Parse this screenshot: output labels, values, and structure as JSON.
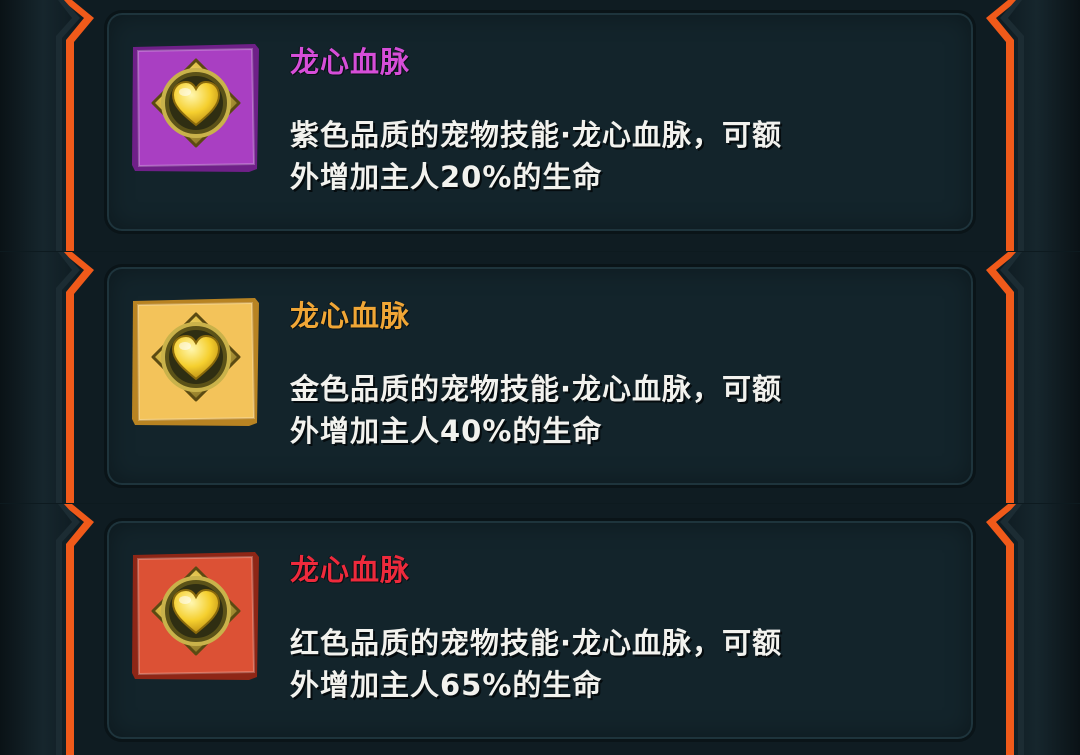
{
  "skills": [
    {
      "name": "龙心血脉",
      "name_color": "#d64ed8",
      "frame_color": "#a93fc2",
      "frame_edge": "#6f2088",
      "icon": "golden-heart-emblem-icon",
      "description_line1": "紫色品质的宠物技能·龙心血脉，可额",
      "description_line2": "外增加主人20%的生命"
    },
    {
      "name": "龙心血脉",
      "name_color": "#f0a636",
      "frame_color": "#f3c35a",
      "frame_edge": "#b88322",
      "icon": "golden-heart-emblem-icon",
      "description_line1": "金色品质的宠物技能·龙心血脉，可额",
      "description_line2": "外增加主人40%的生命"
    },
    {
      "name": "龙心血脉",
      "name_color": "#ee2a3c",
      "frame_color": "#dc5135",
      "frame_edge": "#8e2616",
      "icon": "golden-heart-emblem-icon",
      "description_line1": "红色品质的宠物技能·龙心血脉，可额",
      "description_line2": "外增加主人65%的生命"
    }
  ],
  "theme": {
    "edge_accent": "#f05a1a",
    "card_bg": "#13242b"
  }
}
